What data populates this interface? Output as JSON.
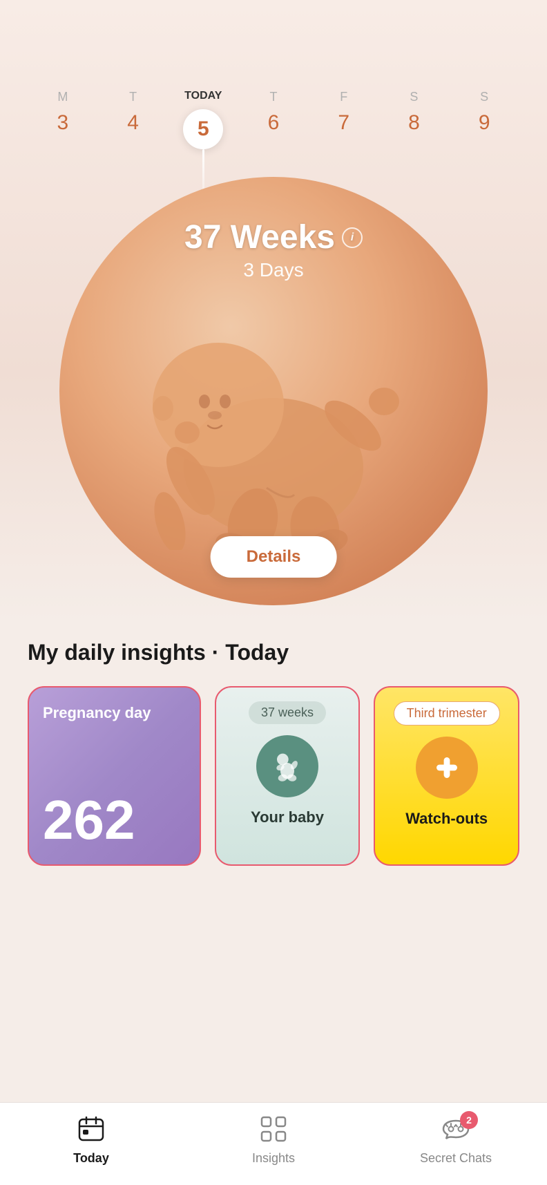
{
  "calendar": {
    "days": [
      {
        "letter": "M",
        "date": "3",
        "isToday": false
      },
      {
        "letter": "T",
        "date": "4",
        "isToday": false
      },
      {
        "letter": "TODAY",
        "date": "5",
        "isToday": true
      },
      {
        "letter": "T",
        "date": "6",
        "isToday": false
      },
      {
        "letter": "F",
        "date": "7",
        "isToday": false
      },
      {
        "letter": "S",
        "date": "8",
        "isToday": false
      },
      {
        "letter": "S",
        "date": "9",
        "isToday": false
      }
    ]
  },
  "pregnancy": {
    "weeks": "37 Weeks",
    "days": "3 Days",
    "details_btn": "Details"
  },
  "insights": {
    "title": "My daily insights · Today",
    "cards": [
      {
        "type": "pregnancy_day",
        "label": "Pregnancy day",
        "number": "262"
      },
      {
        "type": "your_baby",
        "weeks_label": "37 weeks",
        "title": "Your baby"
      },
      {
        "type": "watchouts",
        "badge": "Third trimester",
        "title": "Watch-outs"
      }
    ]
  },
  "bottom_nav": {
    "items": [
      {
        "id": "today",
        "label": "Today",
        "active": true,
        "badge": null
      },
      {
        "id": "insights",
        "label": "Insights",
        "active": false,
        "badge": null
      },
      {
        "id": "secret_chats",
        "label": "Secret Chats",
        "active": false,
        "badge": "2"
      }
    ]
  }
}
